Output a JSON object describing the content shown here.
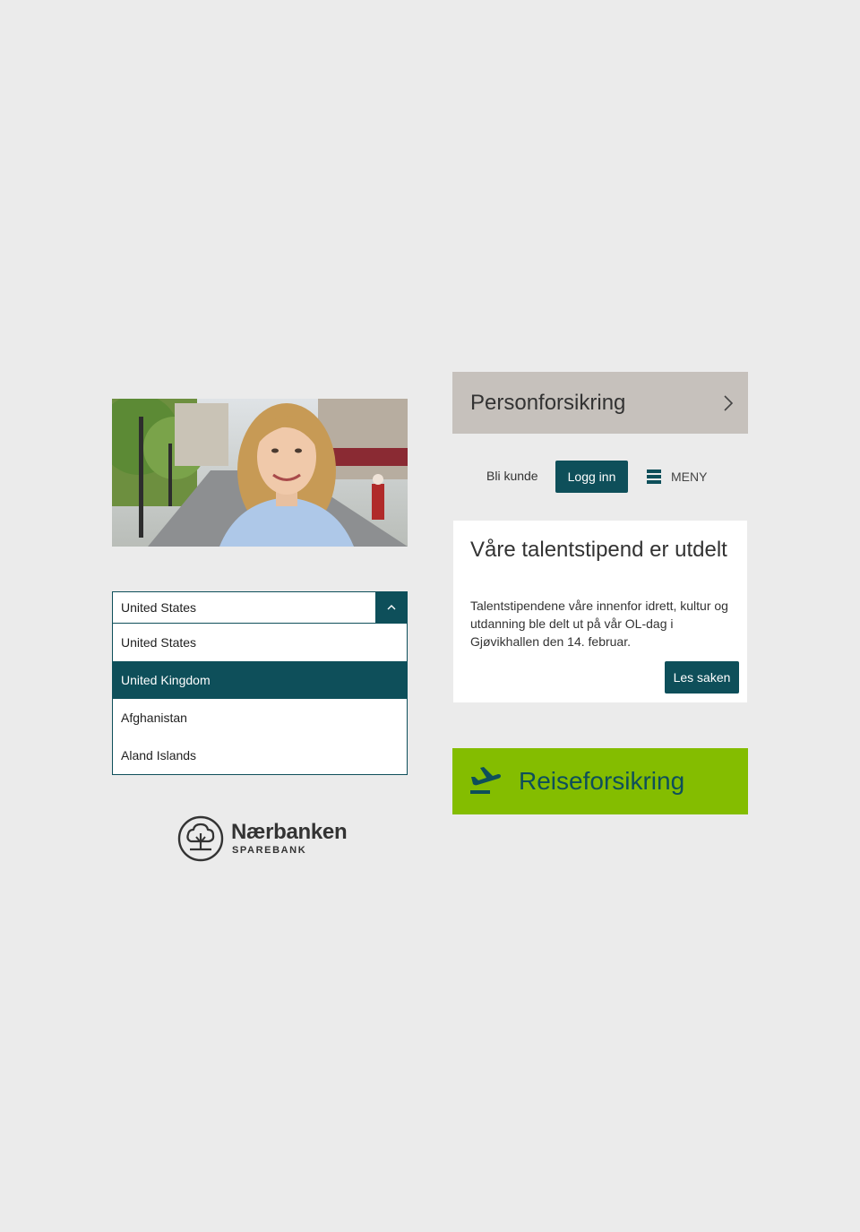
{
  "photo": {
    "icon": "portrait-photo"
  },
  "country_select": {
    "selected_value": "United States",
    "options": [
      {
        "label": "United States",
        "highlighted": false
      },
      {
        "label": "United Kingdom",
        "highlighted": true
      },
      {
        "label": "Afghanistan",
        "highlighted": false
      },
      {
        "label": "Aland Islands",
        "highlighted": false
      }
    ],
    "toggle_icon": "chevron-up-icon"
  },
  "logo": {
    "name": "Nærbanken",
    "sub": "SPAREBANK",
    "icon": "tree-icon"
  },
  "personforsikring": {
    "label": "Personforsikring",
    "icon": "chevron-right-icon"
  },
  "nav": {
    "bli_kunde": "Bli kunde",
    "logg_inn": "Logg inn",
    "meny": "MENY",
    "menu_icon": "hamburger-icon"
  },
  "news": {
    "title": "Våre talentstipend er utdelt",
    "text": "Talentstipendene våre innenfor idrett, kultur og utdanning ble delt ut på vår OL-dag i Gjøvikhallen den 14. februar.",
    "button": "Les saken"
  },
  "reise": {
    "label": "Reiseforsikring",
    "icon": "airplane-departure-icon"
  },
  "colors": {
    "primary": "#0e4f5a",
    "green": "#84bd00",
    "grey_panel": "#c6c1bc",
    "background": "#ebebeb"
  }
}
